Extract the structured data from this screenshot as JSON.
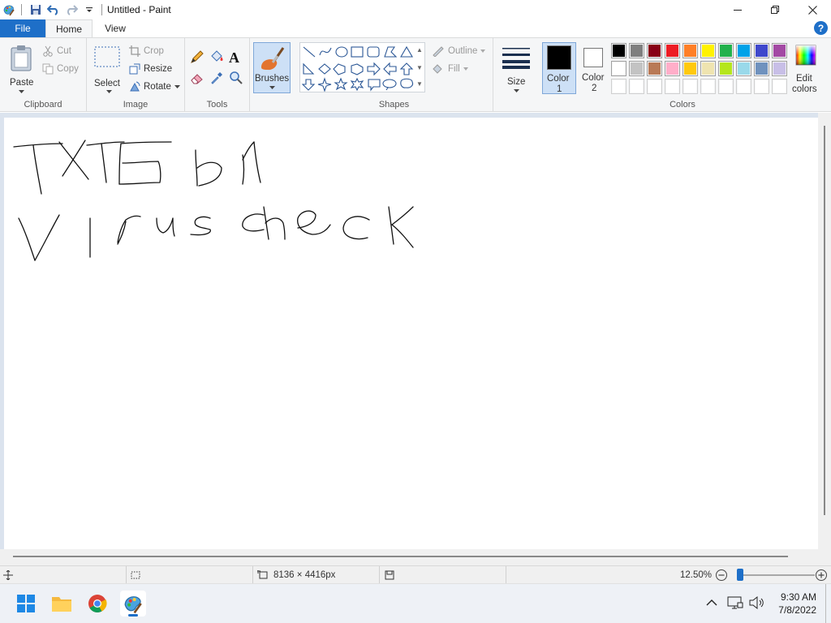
{
  "window": {
    "title": "Untitled - Paint"
  },
  "tabs": {
    "file": "File",
    "home": "Home",
    "view": "View",
    "help": "?"
  },
  "ribbon": {
    "clipboard": {
      "label": "Clipboard",
      "paste": "Paste",
      "cut": "Cut",
      "copy": "Copy"
    },
    "image": {
      "label": "Image",
      "select": "Select",
      "crop": "Crop",
      "resize": "Resize",
      "rotate": "Rotate"
    },
    "tools": {
      "label": "Tools",
      "text_glyph": "A"
    },
    "brushes": {
      "label": "Brushes"
    },
    "shapes": {
      "label": "Shapes",
      "outline": "Outline",
      "fill": "Fill"
    },
    "size": {
      "label": "Size"
    },
    "color1": {
      "line1": "Color",
      "line2": "1"
    },
    "color2": {
      "line1": "Color",
      "line2": "2"
    },
    "colors": {
      "label": "Colors",
      "edit_line1": "Edit",
      "edit_line2": "colors",
      "row1": [
        "#000000",
        "#7f7f7f",
        "#880015",
        "#ed1c24",
        "#ff7f27",
        "#fff200",
        "#22b14c",
        "#00a2e8",
        "#3f48cc",
        "#a349a4"
      ],
      "row2": [
        "#ffffff",
        "#c3c3c3",
        "#b97a57",
        "#ffaec9",
        "#ffc90e",
        "#efe4b0",
        "#b5e61d",
        "#99d9ea",
        "#7092be",
        "#c8bfe7"
      ],
      "row3": [
        "#ffffff",
        "#ffffff",
        "#ffffff",
        "#ffffff",
        "#ffffff",
        "#ffffff",
        "#ffffff",
        "#ffffff",
        "#ffffff",
        "#ffffff"
      ],
      "color1_value": "#000000",
      "color2_value": "#ffffff"
    }
  },
  "status": {
    "image_size": "8136 × 4416px",
    "zoom": "12.50%",
    "zoom_slider_fraction": 0.0
  },
  "taskbar": {
    "time": "9:30 AM",
    "date": "7/8/2022"
  },
  "accent": "#1e6fc8"
}
